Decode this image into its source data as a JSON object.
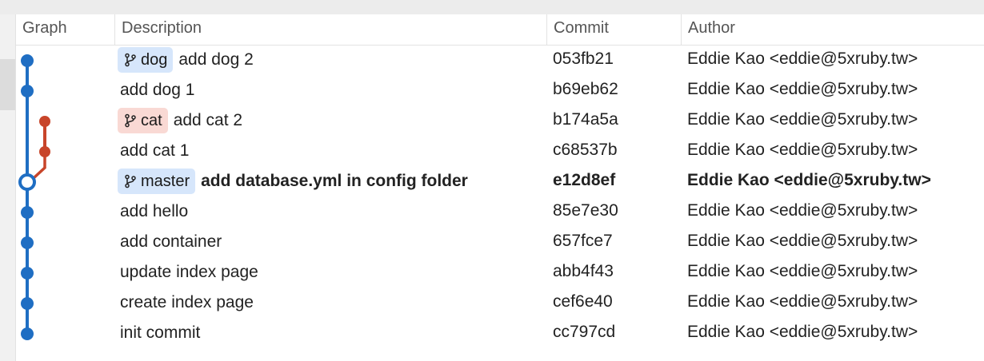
{
  "columns": {
    "graph": "Graph",
    "description": "Description",
    "commit": "Commit",
    "author": "Author"
  },
  "colors": {
    "main_branch": "#1f6ec3",
    "cat_branch": "#c8452a",
    "tag_blue_bg": "#d6e6fb",
    "tag_red_bg": "#f9d9d4"
  },
  "commits": [
    {
      "tag": "dog",
      "tag_color": "blue",
      "message": "add dog 2",
      "hash": "053fb21",
      "author": "Eddie Kao <eddie@5xruby.tw>",
      "lane": "main",
      "current": false
    },
    {
      "tag": "",
      "message": "add dog 1",
      "hash": "b69eb62",
      "author": "Eddie Kao <eddie@5xruby.tw>",
      "lane": "main",
      "current": false
    },
    {
      "tag": "cat",
      "tag_color": "red",
      "message": "add cat 2",
      "hash": "b174a5a",
      "author": "Eddie Kao <eddie@5xruby.tw>",
      "lane": "cat",
      "current": false
    },
    {
      "tag": "",
      "message": "add cat 1",
      "hash": "c68537b",
      "author": "Eddie Kao <eddie@5xruby.tw>",
      "lane": "cat",
      "current": false
    },
    {
      "tag": "master",
      "tag_color": "blue",
      "message": "add database.yml in config folder",
      "hash": "e12d8ef",
      "author": "Eddie Kao <eddie@5xruby.tw>",
      "lane": "main",
      "current": true
    },
    {
      "tag": "",
      "message": "add hello",
      "hash": "85e7e30",
      "author": "Eddie Kao <eddie@5xruby.tw>",
      "lane": "main",
      "current": false
    },
    {
      "tag": "",
      "message": "add container",
      "hash": "657fce7",
      "author": "Eddie Kao <eddie@5xruby.tw>",
      "lane": "main",
      "current": false
    },
    {
      "tag": "",
      "message": "update index page",
      "hash": "abb4f43",
      "author": "Eddie Kao <eddie@5xruby.tw>",
      "lane": "main",
      "current": false
    },
    {
      "tag": "",
      "message": "create index page",
      "hash": "cef6e40",
      "author": "Eddie Kao <eddie@5xruby.tw>",
      "lane": "main",
      "current": false
    },
    {
      "tag": "",
      "message": "init commit",
      "hash": "cc797cd",
      "author": "Eddie Kao <eddie@5xruby.tw>",
      "lane": "main",
      "current": false
    }
  ]
}
